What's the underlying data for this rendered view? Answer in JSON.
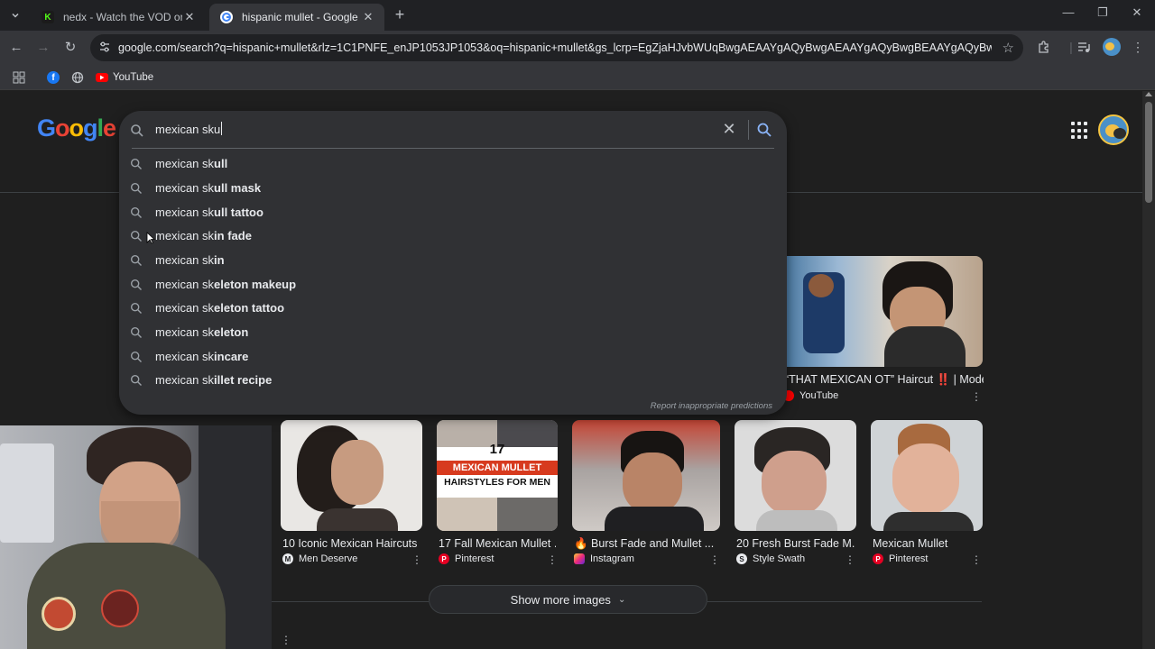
{
  "browser": {
    "tabs": [
      {
        "title": "nedx - Watch the VOD on Kick",
        "favicon": "kick-favicon",
        "active": false
      },
      {
        "title": "hispanic mullet - Google Search",
        "favicon": "google-favicon",
        "active": true
      }
    ],
    "url": "google.com/search?q=hispanic+mullet&rlz=1C1PNFE_enJP1053JP1053&oq=hispanic+mullet&gs_lcrp=EgZjaHJvbWUqBwgAEAAYgAQyBwgAEAAYgAQyBwgBEAAYgAQyBwgCEAAYgAQyC...",
    "bookmarks": [
      {
        "label": "",
        "icon": "facebook-icon"
      },
      {
        "label": "",
        "icon": "globe-icon"
      },
      {
        "label": "YouTube",
        "icon": "youtube-icon"
      }
    ]
  },
  "google": {
    "logo_letters": [
      "G",
      "o",
      "o",
      "g",
      "l",
      "e"
    ],
    "search": {
      "query": "mexican sku",
      "suggestions": [
        {
          "prefix": "mexican sk",
          "completion": "ull"
        },
        {
          "prefix": "mexican sk",
          "completion": "ull mask"
        },
        {
          "prefix": "mexican sk",
          "completion": "ull tattoo"
        },
        {
          "prefix": "mexican sk",
          "completion": "in fade"
        },
        {
          "prefix": "mexican sk",
          "completion": "in"
        },
        {
          "prefix": "mexican sk",
          "completion": "eleton makeup"
        },
        {
          "prefix": "mexican sk",
          "completion": "eleton tattoo"
        },
        {
          "prefix": "mexican sk",
          "completion": "eleton"
        },
        {
          "prefix": "mexican sk",
          "completion": "incare"
        },
        {
          "prefix": "mexican sk",
          "completion": "illet recipe"
        }
      ],
      "report_label": "Report inappropriate predictions"
    },
    "images_top": [
      {
        "caption": "“THAT MEXICAN OT” Haircut ‼️ | Moder...",
        "source": "YouTube",
        "source_icon": "youtube-icon"
      }
    ],
    "images": [
      {
        "caption": "10 Iconic Mexican Haircuts ...",
        "source": "Men Deserve",
        "source_icon": "mendeserve-icon"
      },
      {
        "caption": "17 Fall Mexican Mullet ...",
        "source": "Pinterest",
        "source_icon": "pinterest-icon",
        "overlay": {
          "number": "17",
          "line1": "MEXICAN MULLET",
          "line2": "HAIRSTYLES FOR MEN"
        }
      },
      {
        "caption": "🔥 Burst Fade and Mullet ...",
        "source": "Instagram",
        "source_icon": "instagram-icon"
      },
      {
        "caption": "20 Fresh Burst Fade M...",
        "source": "Style Swath",
        "source_icon": "styleswath-icon"
      },
      {
        "caption": "Mexican Mullet",
        "source": "Pinterest",
        "source_icon": "pinterest-icon"
      }
    ],
    "show_more_label": "Show more images"
  }
}
